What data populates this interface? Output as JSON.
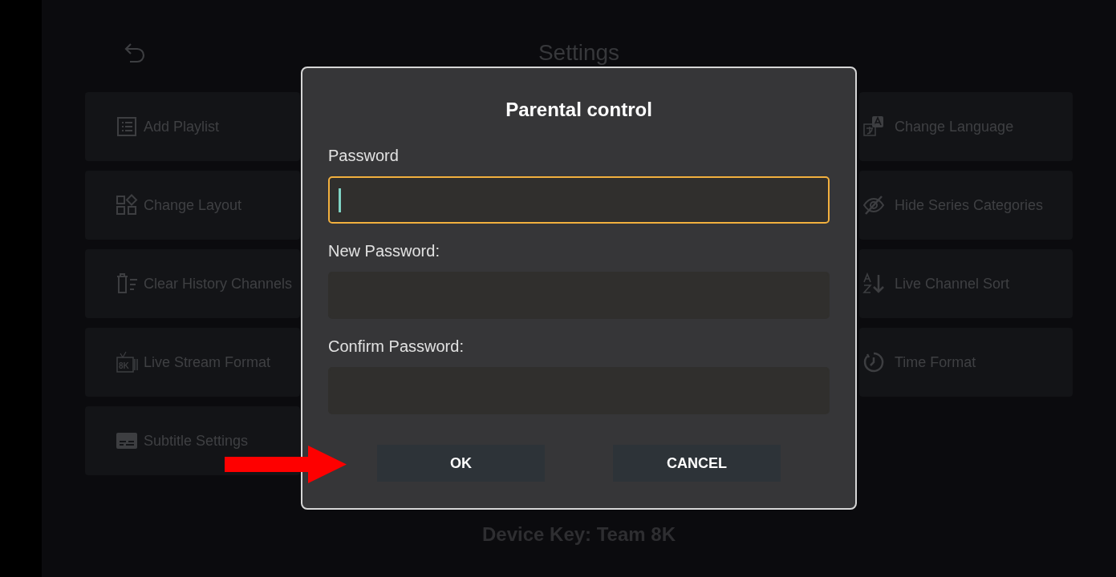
{
  "screen": {
    "title": "Settings"
  },
  "settings_columns": [
    {
      "items": [
        {
          "label": "Add Playlist"
        },
        {
          "label": "Change Layout"
        },
        {
          "label": "Clear History Channels"
        },
        {
          "label": "Live Stream Format",
          "icon_text": "8K"
        },
        {
          "label": "Subtitle Settings"
        }
      ]
    },
    {
      "items": [
        {
          "label": "Change Language"
        },
        {
          "label": "Hide Series Categories"
        },
        {
          "label": "Live Channel Sort"
        },
        {
          "label": "Time Format"
        }
      ]
    }
  ],
  "device_info": [
    "Device Key: Team 8K"
  ],
  "dialog": {
    "title": "Parental control",
    "fields": [
      {
        "label": "Password",
        "focused": true
      },
      {
        "label": "New Password:",
        "focused": false
      },
      {
        "label": "Confirm Password:",
        "focused": false
      }
    ],
    "buttons": [
      {
        "label": "OK"
      },
      {
        "label": "CANCEL"
      }
    ]
  }
}
